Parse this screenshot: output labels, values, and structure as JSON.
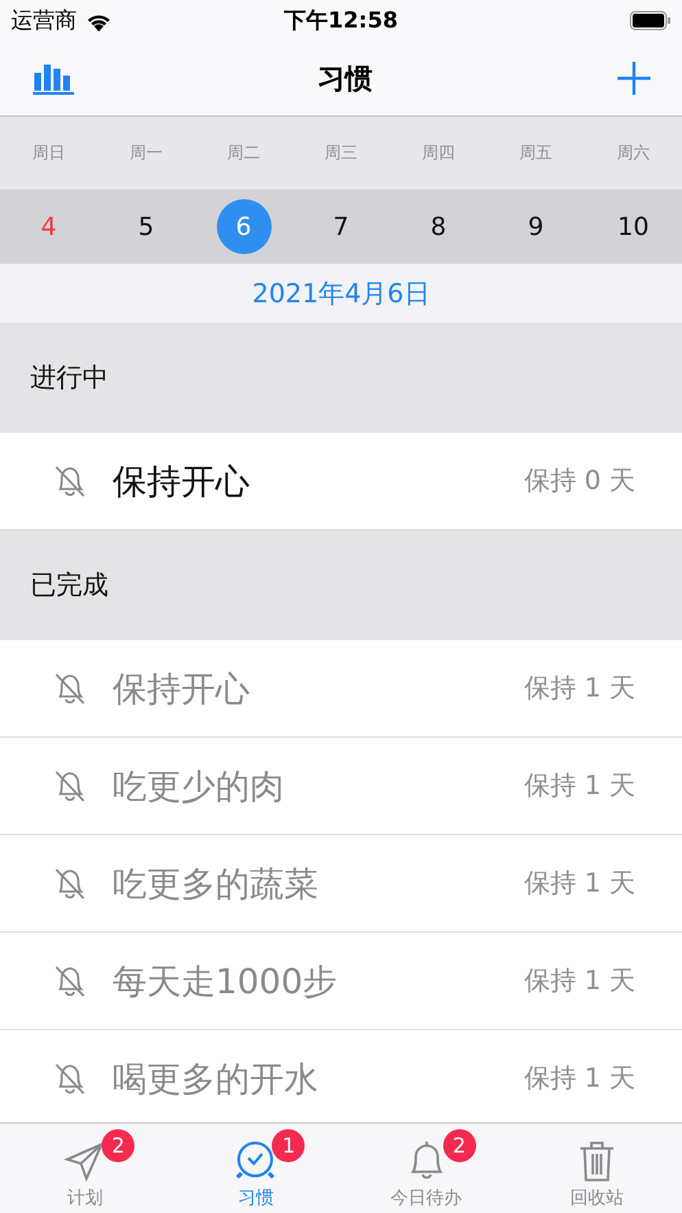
{
  "status_bar": {
    "carrier": "运营商",
    "time": "下午12:58"
  },
  "nav": {
    "title": "习惯"
  },
  "weekdays": [
    "周日",
    "周一",
    "周二",
    "周三",
    "周四",
    "周五",
    "周六"
  ],
  "dates": [
    {
      "day": "4",
      "selected": false,
      "sunday": true
    },
    {
      "day": "5",
      "selected": false,
      "sunday": false
    },
    {
      "day": "6",
      "selected": true,
      "sunday": false
    },
    {
      "day": "7",
      "selected": false,
      "sunday": false
    },
    {
      "day": "8",
      "selected": false,
      "sunday": false
    },
    {
      "day": "9",
      "selected": false,
      "sunday": false
    },
    {
      "day": "10",
      "selected": false,
      "sunday": false
    }
  ],
  "selected_date": "2021年4月6日",
  "sections": [
    {
      "title": "进行中",
      "items": [
        {
          "name": "保持开心",
          "streak": "保持 0 天",
          "done": false
        }
      ]
    },
    {
      "title": "已完成",
      "items": [
        {
          "name": "保持开心",
          "streak": "保持 1 天",
          "done": true
        },
        {
          "name": "吃更少的肉",
          "streak": "保持 1 天",
          "done": true
        },
        {
          "name": "吃更多的蔬菜",
          "streak": "保持 1 天",
          "done": true
        },
        {
          "name": "每天走1000步",
          "streak": "保持 1 天",
          "done": true
        },
        {
          "name": "喝更多的开水",
          "streak": "保持 1 天",
          "done": true
        }
      ]
    }
  ],
  "tab_bar": [
    {
      "kind": "plane",
      "label": "计划",
      "badge": "2",
      "selected": false
    },
    {
      "kind": "clock",
      "label": "习惯",
      "badge": "1",
      "selected": true
    },
    {
      "kind": "bell",
      "label": "今日待办",
      "badge": "2",
      "selected": false
    },
    {
      "kind": "trash",
      "label": "回收站",
      "selected": false
    }
  ]
}
